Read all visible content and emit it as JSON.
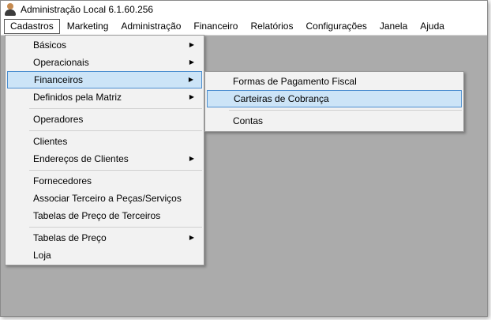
{
  "window": {
    "title": "Administração Local 6.1.60.256"
  },
  "menubar": {
    "items": [
      "Cadastros",
      "Marketing",
      "Administração",
      "Financeiro",
      "Relatórios",
      "Configurações",
      "Janela",
      "Ajuda"
    ]
  },
  "cadastros_menu": {
    "items": [
      {
        "label": "Básicos",
        "submenu": true
      },
      {
        "label": "Operacionais",
        "submenu": true
      },
      {
        "label": "Financeiros",
        "submenu": true
      },
      {
        "label": "Definidos pela Matriz",
        "submenu": true
      },
      {
        "label": "Operadores",
        "submenu": false
      },
      {
        "label": "Clientes",
        "submenu": false
      },
      {
        "label": "Endereços de Clientes",
        "submenu": true
      },
      {
        "label": "Fornecedores",
        "submenu": false
      },
      {
        "label": "Associar Terceiro a Peças/Serviços",
        "submenu": false
      },
      {
        "label": "Tabelas de Preço de Terceiros",
        "submenu": false
      },
      {
        "label": "Tabelas de Preço",
        "submenu": true
      },
      {
        "label": "Loja",
        "submenu": false
      }
    ]
  },
  "financeiros_submenu": {
    "items": [
      {
        "label": "Formas de Pagamento Fiscal"
      },
      {
        "label": "Carteiras de Cobrança"
      },
      {
        "label": "Contas"
      }
    ]
  },
  "icons": {
    "app": "user-icon",
    "submenu": "chevron-right-icon"
  }
}
